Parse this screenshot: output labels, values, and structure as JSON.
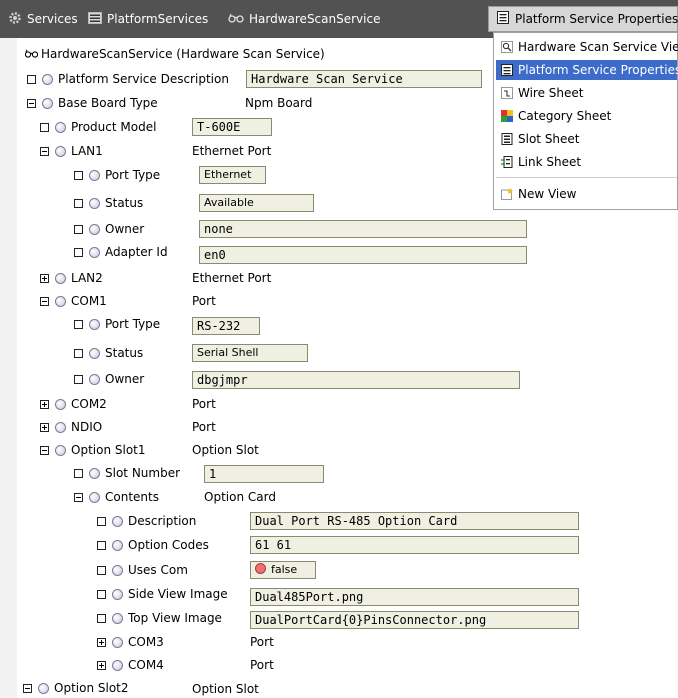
{
  "topbar": {
    "services_label": "Services",
    "platform_services_label": "PlatformServices",
    "hardware_scan_label": "HardwareScanService",
    "view_button_label": "Platform Service Properties"
  },
  "tree": {
    "header": "HardwareScanService  (Hardware Scan Service)",
    "rows": [
      {
        "label": "Platform Service Description",
        "field": "Hardware Scan Service"
      },
      {
        "label": "Base Board Type",
        "value": "Npm Board"
      },
      {
        "label": "Product Model",
        "field": "T-600E"
      },
      {
        "label": "LAN1",
        "value": "Ethernet Port"
      },
      {
        "label": "Port Type",
        "field": "Ethernet"
      },
      {
        "label": "Status",
        "field": "Available"
      },
      {
        "label": "Owner",
        "field": "none"
      },
      {
        "label": "Adapter Id",
        "field": "en0"
      },
      {
        "label": "LAN2",
        "value": "Ethernet Port"
      },
      {
        "label": "COM1",
        "value": "Port"
      },
      {
        "label": "Port Type",
        "field": "RS-232"
      },
      {
        "label": "Status",
        "field": "Serial Shell"
      },
      {
        "label": "Owner",
        "field": "dbgjmpr"
      },
      {
        "label": "COM2",
        "value": "Port"
      },
      {
        "label": "NDIO",
        "value": "Port"
      },
      {
        "label": "Option Slot1",
        "value": "Option Slot"
      },
      {
        "label": "Slot Number",
        "field": "1"
      },
      {
        "label": "Contents",
        "value": "Option Card"
      },
      {
        "label": "Description",
        "field": "Dual Port RS-485 Option Card"
      },
      {
        "label": "Option Codes",
        "field": "61 61"
      },
      {
        "label": "Uses Com",
        "field": "false"
      },
      {
        "label": "Side View Image",
        "field": "Dual485Port.png"
      },
      {
        "label": "Top View Image",
        "field": "DualPortCard{0}PinsConnector.png"
      },
      {
        "label": "COM3",
        "value": "Port"
      },
      {
        "label": "COM4",
        "value": "Port"
      },
      {
        "label": "Option Slot2",
        "value": "Option Slot"
      }
    ]
  },
  "menu": {
    "items": [
      "Hardware Scan Service View",
      "Platform Service Properties",
      "Wire Sheet",
      "Category Sheet",
      "Slot Sheet",
      "Link Sheet",
      "New View"
    ]
  },
  "colors": {
    "topbar": "#525252",
    "menu_selected": "#3d6bc9",
    "field_bg": "#efefe2",
    "false_dot": "#f07070"
  },
  "icons": {
    "services": "gear-icon",
    "platform_services": "list-icon",
    "hardware_scan": "glasses-icon",
    "view_button": "sheet-icon"
  }
}
